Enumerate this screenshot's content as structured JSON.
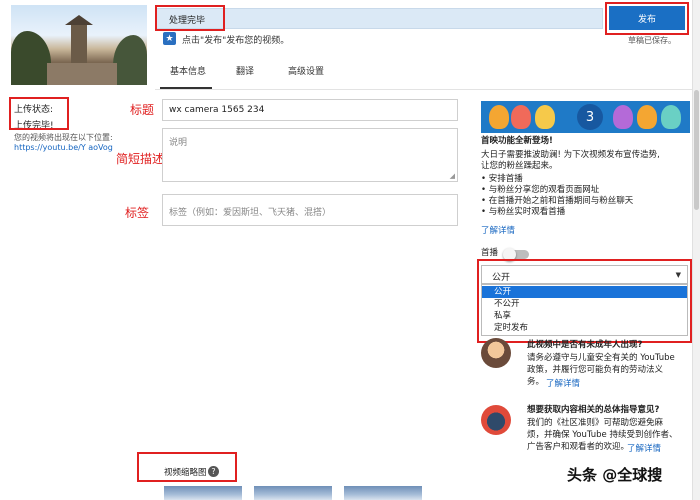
{
  "header": {
    "title_value": "处理完毕",
    "publish_label": "发布",
    "publish_hint": "点击\"发布\"发布您的视频。",
    "saved_text": "草稿已保存。"
  },
  "tabs": [
    {
      "label": "基本信息",
      "active": true
    },
    {
      "label": "翻译",
      "active": false
    },
    {
      "label": "高级设置",
      "active": false
    }
  ],
  "status": {
    "label": "上传状态:",
    "value": "上传完毕!",
    "view_at": "您的视频将出现在以下位置:",
    "url": "https://youtu.be/Y        aoVog"
  },
  "annotations": {
    "title": "标题",
    "description": "简短描述",
    "tags": "标签"
  },
  "form": {
    "title_value": "wx camera 1565         234",
    "description_placeholder": "说明",
    "tags_placeholder": "标签（例如：爱因斯坦、飞天猪、混搭）"
  },
  "promo": {
    "badge_number": "3",
    "heading": "首映功能全新登场!",
    "line1": "大日子需要推波助澜! 为下次视频发布宣传造势,",
    "line2": "让您的粉丝躁起来。",
    "bullets": [
      "• 安排首播",
      "• 与粉丝分享您的观看页面网址",
      "• 在首播开始之前和首播期间与粉丝聊天",
      "• 与粉丝实时观看首播"
    ],
    "learn_more": "了解详情"
  },
  "premiere": {
    "label": "首播"
  },
  "visibility": {
    "selected": "公开",
    "options": [
      "公开",
      "不公开",
      "私享",
      "定时发布"
    ]
  },
  "info1": {
    "heading": "此视频中是否有未成年人出现?",
    "line1": "请务必遵守与儿童安全有关的 YouTube",
    "line2": "政策，并履行您可能负有的劳动法义",
    "line3": "务。",
    "learn_more": "了解详情"
  },
  "info2": {
    "heading": "想要获取内容相关的总体指导意见?",
    "line1": "我们的《社区准则》可帮助您避免麻",
    "line2": "烦，并确保 YouTube 持续受到创作者、",
    "line3": "广告客户和观看者的欢迎。",
    "learn_more": "了解详情"
  },
  "thumbnails": {
    "label": "视频缩略图",
    "help_icon": "?"
  },
  "watermark": "头条 @全球搜",
  "colors": {
    "accent": "#1a6fc4",
    "annotation_red": "#e02020"
  }
}
